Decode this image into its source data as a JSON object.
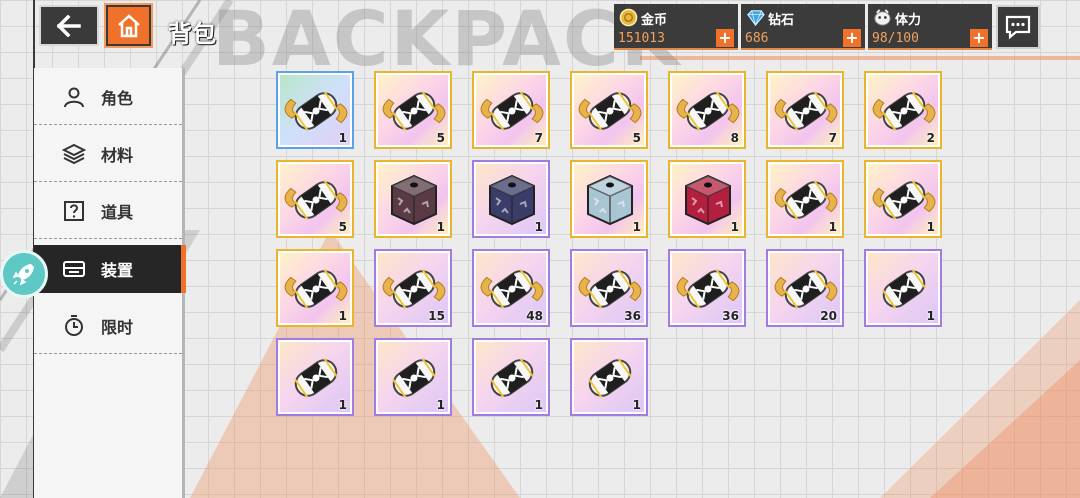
{
  "header": {
    "title": "背包",
    "watermark": "BACKPACK"
  },
  "resources": [
    {
      "name": "gold",
      "label": "金币",
      "value": "151013",
      "icon": "gold-coin-icon"
    },
    {
      "name": "diamond",
      "label": "钻石",
      "value": "686",
      "icon": "diamond-icon"
    },
    {
      "name": "stamina",
      "label": "体力",
      "value": "98/100",
      "icon": "stamina-icon"
    }
  ],
  "resource_plus": "+",
  "sidebar": {
    "items": [
      {
        "label": "角色",
        "icon": "person-icon",
        "active": false
      },
      {
        "label": "材料",
        "icon": "layers-icon",
        "active": false
      },
      {
        "label": "道具",
        "icon": "question-box-icon",
        "active": false
      },
      {
        "label": "装置",
        "icon": "device-icon",
        "active": true
      },
      {
        "label": "限时",
        "icon": "timer-icon",
        "active": false
      }
    ]
  },
  "inventory": [
    {
      "kind": "capsule",
      "rarity": "blue",
      "count": "1"
    },
    {
      "kind": "capsule",
      "rarity": "gold",
      "count": "5"
    },
    {
      "kind": "capsule",
      "rarity": "gold",
      "count": "7"
    },
    {
      "kind": "capsule",
      "rarity": "gold",
      "count": "5"
    },
    {
      "kind": "capsule",
      "rarity": "gold",
      "count": "8"
    },
    {
      "kind": "capsule",
      "rarity": "gold",
      "count": "7"
    },
    {
      "kind": "capsule",
      "rarity": "gold",
      "count": "2"
    },
    {
      "kind": "capsule",
      "rarity": "gold",
      "count": "5"
    },
    {
      "kind": "cube",
      "rarity": "gold",
      "count": "1",
      "color": "#5a3b45"
    },
    {
      "kind": "cube",
      "rarity": "purple",
      "count": "1",
      "color": "#3a3c6a"
    },
    {
      "kind": "cube",
      "rarity": "gold",
      "count": "1",
      "color": "#a9c4d3"
    },
    {
      "kind": "cube",
      "rarity": "gold",
      "count": "1",
      "color": "#b3203f"
    },
    {
      "kind": "capsule",
      "rarity": "gold",
      "count": "1"
    },
    {
      "kind": "capsule",
      "rarity": "gold",
      "count": "1"
    },
    {
      "kind": "capsule",
      "rarity": "gold",
      "count": "1"
    },
    {
      "kind": "capsule",
      "rarity": "purple",
      "count": "15"
    },
    {
      "kind": "capsule",
      "rarity": "purple",
      "count": "48"
    },
    {
      "kind": "capsule",
      "rarity": "purple",
      "count": "36"
    },
    {
      "kind": "capsule",
      "rarity": "purple",
      "count": "36"
    },
    {
      "kind": "capsule",
      "rarity": "purple",
      "count": "20"
    },
    {
      "kind": "capsule-plain",
      "rarity": "purple",
      "count": "1"
    },
    {
      "kind": "capsule-plain",
      "rarity": "purple",
      "count": "1"
    },
    {
      "kind": "capsule-plain",
      "rarity": "purple",
      "count": "1"
    },
    {
      "kind": "capsule-plain",
      "rarity": "purple",
      "count": "1"
    },
    {
      "kind": "capsule-plain",
      "rarity": "purple",
      "count": "1"
    }
  ],
  "colors": {
    "accent": "#f0722a",
    "dark": "#3a3a3a",
    "resource_value": "#f3a15e"
  }
}
